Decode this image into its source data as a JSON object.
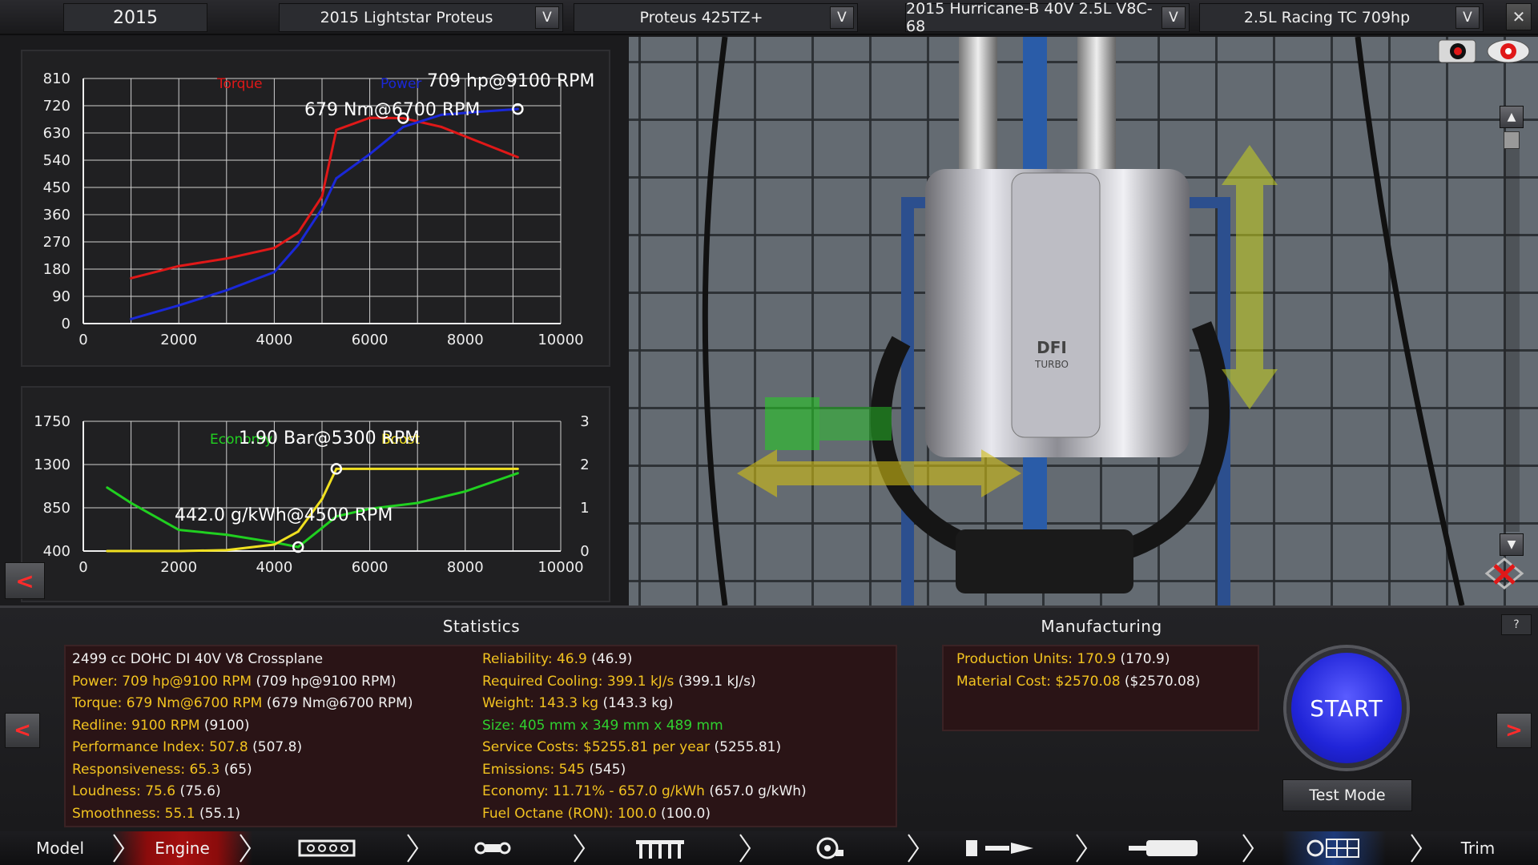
{
  "topbar": {
    "year": "2015",
    "model": "2015 Lightstar Proteus",
    "trim": "Proteus 425TZ+",
    "engine_family": "2015 Hurricane-B 40V 2.5L V8C-68",
    "engine_variant": "2.5L Racing TC 709hp",
    "dropdown_glyph": "V",
    "close_glyph": "✕"
  },
  "chart_data": [
    {
      "type": "line",
      "x": [
        1000,
        2000,
        3000,
        4000,
        4500,
        5000,
        5300,
        6000,
        6700,
        7500,
        8300,
        9100
      ],
      "series": [
        {
          "name": "Torque",
          "color": "#e01818",
          "values": [
            150,
            190,
            215,
            250,
            300,
            420,
            640,
            680,
            679,
            650,
            600,
            550
          ]
        },
        {
          "name": "Power",
          "color": "#1a28d8",
          "values": [
            15,
            60,
            110,
            170,
            260,
            380,
            480,
            560,
            650,
            690,
            700,
            709
          ]
        }
      ],
      "annotations": [
        "709 hp@9100 RPM",
        "679 Nm@6700 RPM"
      ],
      "y_ticks": [
        "810",
        "720",
        "630",
        "540",
        "450",
        "360",
        "270",
        "180",
        "90",
        "0"
      ],
      "x_ticks": [
        "0",
        "2000",
        "4000",
        "6000",
        "8000",
        "10000"
      ],
      "xlim": [
        0,
        10000
      ],
      "ylim": [
        0,
        810
      ],
      "grid": true
    },
    {
      "type": "line",
      "x": [
        500,
        1000,
        2000,
        3000,
        4000,
        4500,
        5000,
        5300,
        6000,
        7000,
        8000,
        9100
      ],
      "series": [
        {
          "name": "Economy",
          "color": "#20d020",
          "values": [
            1060,
            900,
            620,
            570,
            490,
            442,
            640,
            760,
            840,
            900,
            1020,
            1210
          ],
          "axis": "left"
        },
        {
          "name": "Boost",
          "color": "#f0e020",
          "values": [
            0,
            0,
            0,
            0.02,
            0.15,
            0.45,
            1.2,
            1.9,
            1.9,
            1.9,
            1.9,
            1.9
          ],
          "axis": "right"
        }
      ],
      "annotations": [
        "1.90 Bar@5300 RPM",
        "442.0 g/kWh@4500 RPM"
      ],
      "y_ticks_left": [
        "1750",
        "1300",
        "850",
        "400"
      ],
      "y_ticks_right": [
        "3",
        "2",
        "1",
        "0"
      ],
      "x_ticks": [
        "0",
        "2000",
        "4000",
        "6000",
        "8000",
        "10000"
      ],
      "xlim": [
        0,
        10000
      ],
      "ylim_left": [
        400,
        1750
      ],
      "ylim_right": [
        0,
        3
      ],
      "grid": true
    }
  ],
  "engine_label": {
    "line1": "DFI",
    "line2": "TURBO"
  },
  "statistics": {
    "title": "Statistics",
    "left": [
      {
        "key": "2499 cc DOHC DI 40V V8 Crossplane",
        "val": ""
      },
      {
        "key": "Power: 709 hp@9100 RPM",
        "val": "(709 hp@9100 RPM)"
      },
      {
        "key": "Torque: 679 Nm@6700 RPM",
        "val": "(679 Nm@6700 RPM)"
      },
      {
        "key": "Redline: 9100 RPM",
        "val": "(9100)"
      },
      {
        "key": "Performance Index: 507.8",
        "val": "(507.8)"
      },
      {
        "key": "Responsiveness: 65.3",
        "val": "(65)"
      },
      {
        "key": "Loudness: 75.6",
        "val": "(75.6)"
      },
      {
        "key": "Smoothness: 55.1",
        "val": "(55.1)"
      }
    ],
    "right": [
      {
        "key": "Reliability: 46.9",
        "val": "(46.9)"
      },
      {
        "key": "Required Cooling: 399.1 kJ/s",
        "val": "(399.1 kJ/s)"
      },
      {
        "key": "Weight: 143.3 kg",
        "val": "(143.3 kg)"
      },
      {
        "key": "Size: 405 mm x 349 mm x 489 mm",
        "val": ""
      },
      {
        "key": "Service Costs: $5255.81 per year",
        "val": "(5255.81)"
      },
      {
        "key": "Emissions: 545",
        "val": "(545)"
      },
      {
        "key": "Economy: 11.71% - 657.0 g/kWh",
        "val": "(657.0 g/kWh)"
      },
      {
        "key": "Fuel Octane (RON): 100.0",
        "val": "(100.0)"
      }
    ]
  },
  "manufacturing": {
    "title": "Manufacturing",
    "lines": [
      {
        "key": "Production Units: 170.9",
        "val": "(170.9)"
      },
      {
        "key": "Material Cost: $2570.08",
        "val": "($2570.08)"
      }
    ]
  },
  "actions": {
    "start": "START",
    "test_mode": "Test Mode",
    "help": "?",
    "prev": "<",
    "next": ">"
  },
  "nav": {
    "items": [
      "Model",
      "Engine",
      "Trim"
    ],
    "icons": [
      "engine-block-icon",
      "crank-icon",
      "valvetrain-icon",
      "turbo-icon",
      "fuel-system-icon",
      "exhaust-icon",
      "tune-icon"
    ]
  },
  "colors": {
    "accent_red": "#ff2b2b",
    "stat_yellow": "#f2c320",
    "stat_green": "#2fd02f",
    "start_blue": "#2024d8"
  }
}
